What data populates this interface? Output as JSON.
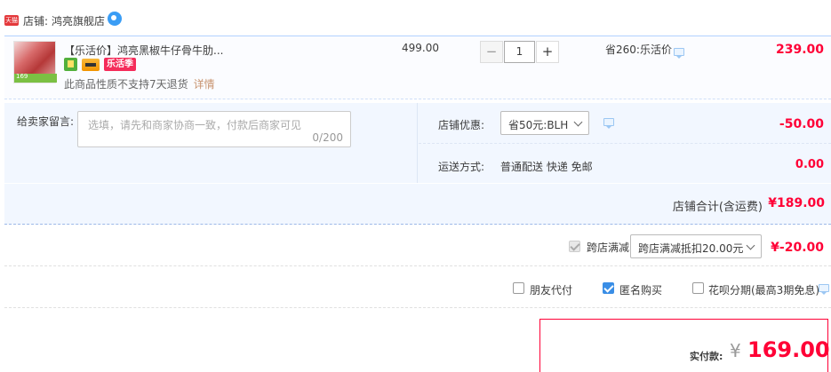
{
  "shop": {
    "tmall_badge": "天猫",
    "label": "店铺:",
    "name": "鸿亮旗舰店"
  },
  "item": {
    "title": "【乐活价】鸿亮黑椒牛仔骨牛肋...",
    "thumb_tag": "169",
    "badge_text": "乐活季",
    "return_note": "此商品性质不支持7天退货",
    "detail_link": "详情",
    "unit_price": "499.00",
    "quantity": "1",
    "minus": "−",
    "plus": "+",
    "promo": "省260:乐活价",
    "total": "239.00"
  },
  "message": {
    "label": "给卖家留言:",
    "placeholder": "选填，请先和商家协商一致，付款后商家可见",
    "count": "0/200"
  },
  "coupon": {
    "label": "店铺优惠:",
    "selected": "省50元:BLH",
    "amount": "-50.00"
  },
  "shipping": {
    "label": "运送方式:",
    "method": "普通配送 快递 免邮",
    "fee": "0.00"
  },
  "shop_total": {
    "label": "店铺合计(含运费)",
    "value": "¥189.00"
  },
  "cross_store": {
    "label": "跨店满减",
    "selected": "跨店满减抵扣20.00元",
    "amount": "¥-20.00"
  },
  "options": {
    "friend_pay": "朋友代付",
    "anonymous": "匿名购买",
    "installment": "花呗分期(最高3期免息)"
  },
  "payment": {
    "label": "实付款:",
    "symbol": "¥",
    "amount": "169.00"
  },
  "colors": {
    "accent_red": "#ff0036",
    "light_blue_bg": "#f2f7ff",
    "checkbox_blue": "#3a8ee6"
  }
}
